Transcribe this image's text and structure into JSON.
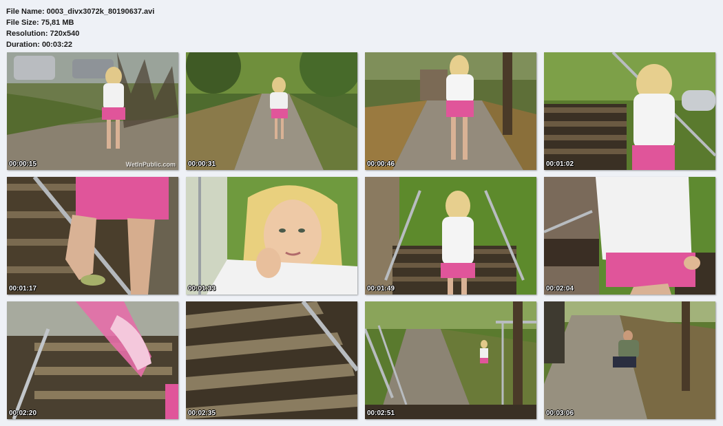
{
  "file_info": {
    "file_name": "File Name: 0003_divx3072k_80190637.avi",
    "file_size": "File Size: 75,81 MB",
    "resolution": "Resolution: 720x540",
    "duration": "Duration: 00:03:22"
  },
  "watermark": "WetInPublic.com",
  "thumbnails": [
    {
      "time": "00:00:15",
      "scene": "park-path-walking-away"
    },
    {
      "time": "00:00:31",
      "scene": "park-path-walking"
    },
    {
      "time": "00:00:46",
      "scene": "path-to-stairs"
    },
    {
      "time": "00:01:02",
      "scene": "climbing-stairs"
    },
    {
      "time": "00:01:17",
      "scene": "legs-on-stairs-closeup"
    },
    {
      "time": "00:01:33",
      "scene": "face-closeup"
    },
    {
      "time": "00:01:49",
      "scene": "standing-on-stairs"
    },
    {
      "time": "00:02:04",
      "scene": "stairs-side-view"
    },
    {
      "time": "00:02:20",
      "scene": "stairs-blur-closeup"
    },
    {
      "time": "00:02:35",
      "scene": "stairs-steps-closeup"
    },
    {
      "time": "00:02:51",
      "scene": "stairs-descending-view"
    },
    {
      "time": "00:03:06",
      "scene": "man-sitting-path"
    }
  ]
}
